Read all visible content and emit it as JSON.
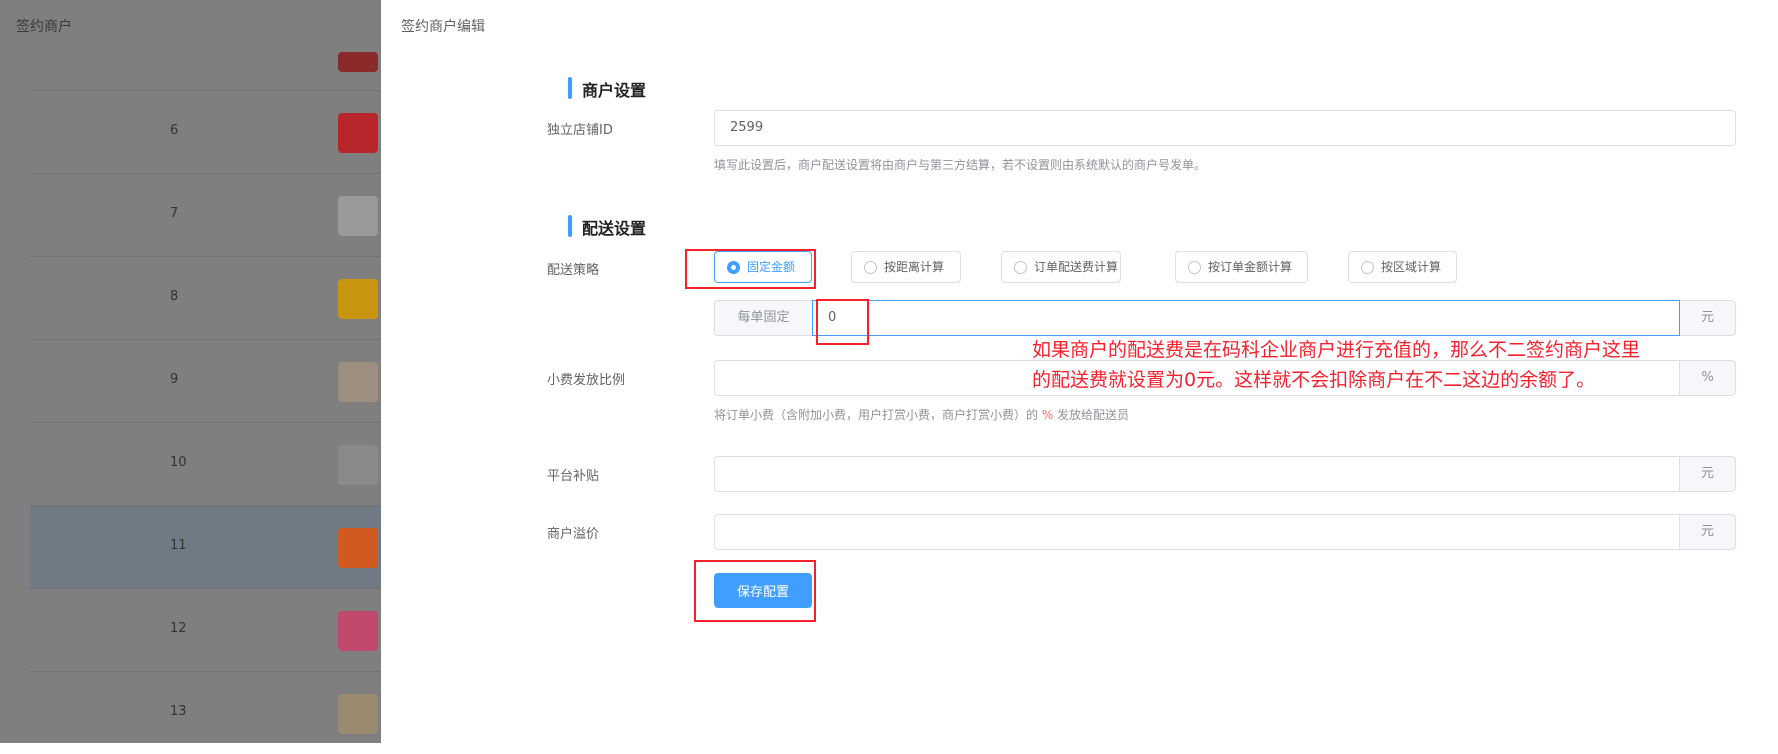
{
  "list": {
    "title": "签约商户",
    "rows": [
      {
        "num": "",
        "color": "#8a2a2a"
      },
      {
        "num": "6",
        "color": "#b8262b"
      },
      {
        "num": "7",
        "color": "#9a9a9a"
      },
      {
        "num": "8",
        "color": "#c8960e"
      },
      {
        "num": "9",
        "color": "#9c8f80"
      },
      {
        "num": "10",
        "color": "#8a8a8a"
      },
      {
        "num": "11",
        "color": "#d05a20"
      },
      {
        "num": "12",
        "color": "#c0486a"
      },
      {
        "num": "13",
        "color": "#9a8a70"
      }
    ]
  },
  "panel": {
    "title": "签约商户编辑",
    "merchant_section": "商户设置",
    "store_id_label": "独立店铺ID",
    "store_id_value": "2599",
    "store_id_hint": "填写此设置后，商户配送设置将由商户与第三方结算，若不设置则由系统默认的商户号发单。",
    "delivery_section": "配送设置",
    "strategy_label": "配送策略",
    "strategies": [
      "固定金额",
      "按距离计算",
      "订单配送费计算",
      "按订单金额计算",
      "按区域计算"
    ],
    "fixed_prefix": "每单固定",
    "fixed_value": "0",
    "fixed_unit": "元",
    "tip_label": "小费发放比例",
    "tip_unit": "%",
    "tip_hint_a": "将订单小费（含附加小费，用户打赏小费，商户打赏小费）的 ",
    "tip_hint_pct": "%",
    "tip_hint_b": " 发放给配送员",
    "subsidy_label": "平台补贴",
    "subsidy_unit": "元",
    "premium_label": "商户溢价",
    "premium_unit": "元",
    "save_label": "保存配置"
  },
  "annotation": {
    "line1": "如果商户的配送费是在码科企业商户进行充值的，那么不二签约商户这里",
    "line2": "的配送费就设置为0元。这样就不会扣除商户在不二这边的余额了。"
  }
}
